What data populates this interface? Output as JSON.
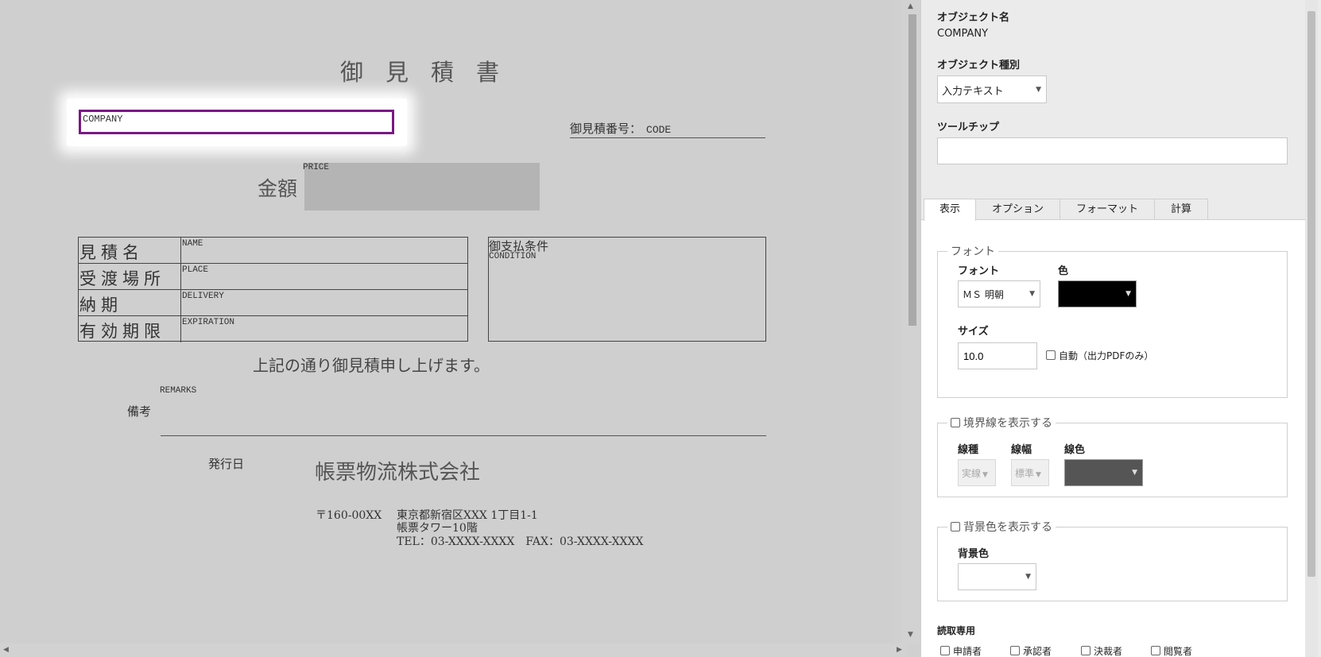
{
  "document": {
    "title": "御見積書",
    "company_field": "COMPANY",
    "quote_number_label": "御見積番号：",
    "quote_number_field": "CODE",
    "amount_label": "金額",
    "price_field": "PRICE",
    "info_rows": [
      {
        "label": "見積名",
        "field": "NAME"
      },
      {
        "label": "受渡場所",
        "field": "PLACE"
      },
      {
        "label": "納期",
        "field": "DELIVERY"
      },
      {
        "label": "有効期限",
        "field": "EXPIRATION"
      }
    ],
    "condition_label": "御支払条件",
    "condition_field": "CONDITION",
    "statement": "上記の通り御見積申し上げます。",
    "remarks_field": "REMARKS",
    "remarks_label": "備考",
    "issue_date_label": "発行日",
    "company_name": "帳票物流株式会社",
    "postal": "〒160-00XX",
    "address_line1": "東京都新宿区XXX 1丁目1-1",
    "address_line2": "帳票タワー10階",
    "address_line3": "TEL：03-XXXX-XXXX　FAX：03-XXXX-XXXX",
    "selection_color": "#7a1785"
  },
  "panel": {
    "object_name_label": "オブジェクト名",
    "object_name_value": "COMPANY",
    "object_type_label": "オブジェクト種別",
    "object_type_value": "入力テキスト",
    "tooltip_label": "ツールチップ",
    "tooltip_value": "",
    "tabs": [
      {
        "label": "表示",
        "active": true
      },
      {
        "label": "オプション",
        "active": false
      },
      {
        "label": "フォーマット",
        "active": false
      },
      {
        "label": "計算",
        "active": false
      }
    ],
    "font_section": {
      "legend": "フォント",
      "font_label": "フォント",
      "font_value": "ＭＳ 明朝",
      "color_label": "色",
      "color_value": "#000000",
      "size_label": "サイズ",
      "size_value": "10.0",
      "auto_label": "自動（出力PDFのみ）"
    },
    "border_section": {
      "legend": "境界線を表示する",
      "line_type_label": "線種",
      "line_type_value": "実線",
      "line_width_label": "線幅",
      "line_width_value": "標準",
      "line_color_label": "線色",
      "line_color_value": "#555555"
    },
    "background_section": {
      "legend": "背景色を表示する",
      "bg_color_label": "背景色",
      "bg_color_value": ""
    },
    "readonly_label": "読取専用",
    "roles": [
      "申請者",
      "承認者",
      "決裁者",
      "閲覧者"
    ]
  }
}
